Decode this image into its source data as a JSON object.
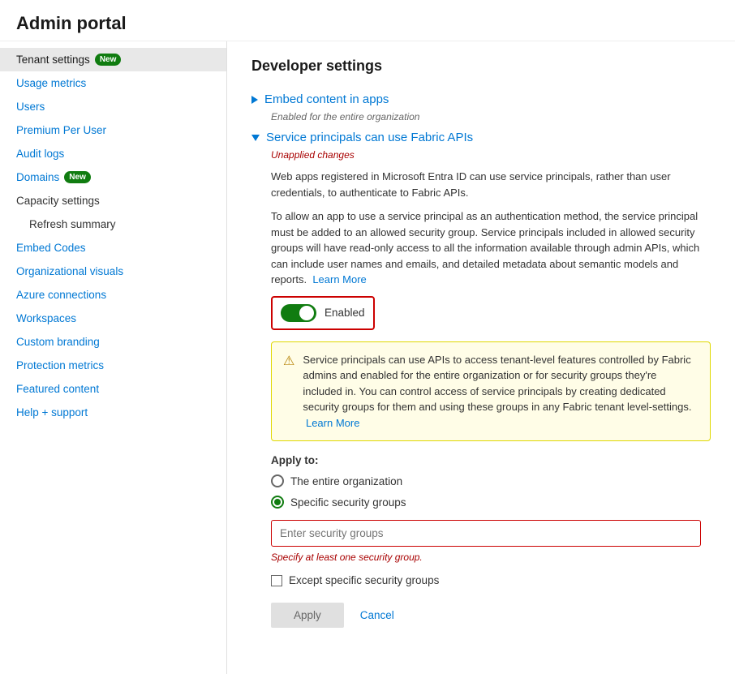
{
  "page": {
    "title": "Admin portal"
  },
  "sidebar": {
    "items": [
      {
        "id": "tenant-settings",
        "label": "Tenant settings",
        "badge": "New",
        "active": true,
        "link": true
      },
      {
        "id": "usage-metrics",
        "label": "Usage metrics",
        "active": false,
        "link": true
      },
      {
        "id": "users",
        "label": "Users",
        "active": false,
        "link": true
      },
      {
        "id": "premium-per-user",
        "label": "Premium Per User",
        "active": false,
        "link": true
      },
      {
        "id": "audit-logs",
        "label": "Audit logs",
        "active": false,
        "link": true
      },
      {
        "id": "domains",
        "label": "Domains",
        "badge": "New",
        "active": false,
        "link": true
      },
      {
        "id": "capacity-settings",
        "label": "Capacity settings",
        "active": false,
        "link": false
      },
      {
        "id": "refresh-summary",
        "label": "Refresh summary",
        "active": false,
        "link": false,
        "sub": true
      },
      {
        "id": "embed-codes",
        "label": "Embed Codes",
        "active": false,
        "link": true
      },
      {
        "id": "organizational-visuals",
        "label": "Organizational visuals",
        "active": false,
        "link": true
      },
      {
        "id": "azure-connections",
        "label": "Azure connections",
        "active": false,
        "link": true
      },
      {
        "id": "workspaces",
        "label": "Workspaces",
        "active": false,
        "link": true
      },
      {
        "id": "custom-branding",
        "label": "Custom branding",
        "active": false,
        "link": true
      },
      {
        "id": "protection-metrics",
        "label": "Protection metrics",
        "active": false,
        "link": true
      },
      {
        "id": "featured-content",
        "label": "Featured content",
        "active": false,
        "link": true
      },
      {
        "id": "help-support",
        "label": "Help + support",
        "active": false,
        "link": true
      }
    ]
  },
  "content": {
    "section_title": "Developer settings",
    "collapsed_item": {
      "title": "Embed content in apps",
      "subtitle": "Enabled for the entire organization"
    },
    "expanded_item": {
      "title": "Service principals can use Fabric APIs",
      "unapplied_label": "Unapplied changes",
      "description1": "Web apps registered in Microsoft Entra ID can use service principals, rather than user credentials, to authenticate to Fabric APIs.",
      "description2": "To allow an app to use a service principal as an authentication method, the service principal must be added to an allowed security group. Service principals included in allowed security groups will have read-only access to all the information available through admin APIs, which can include user names and emails, and detailed metadata about semantic models and reports.",
      "learn_more_1": "Learn More",
      "toggle_label": "Enabled",
      "warning_text": "Service principals can use APIs to access tenant-level features controlled by Fabric admins and enabled for the entire organization or for security groups they're included in. You can control access of service principals by creating dedicated security groups for them and using these groups in any Fabric tenant level-settings.",
      "learn_more_2": "Learn More",
      "apply_to_label": "Apply to:",
      "radio_options": [
        {
          "id": "entire-org",
          "label": "The entire organization",
          "selected": false
        },
        {
          "id": "specific-groups",
          "label": "Specific security groups",
          "selected": true
        }
      ],
      "input_placeholder": "Enter security groups",
      "input_hint": "Specify at least one security group.",
      "checkbox_label": "Except specific security groups",
      "btn_apply": "Apply",
      "btn_cancel": "Cancel"
    }
  }
}
